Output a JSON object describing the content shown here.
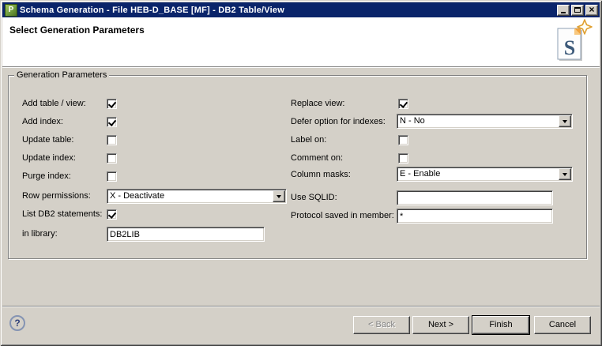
{
  "window": {
    "title": "Schema Generation - File HEB-D_BASE [MF] - DB2 Table/View",
    "app_icon_letter": "P",
    "close_glyph": "×"
  },
  "header": {
    "title": "Select Generation Parameters",
    "icon_letter": "S"
  },
  "group": {
    "title": "Generation Parameters"
  },
  "form": {
    "left": {
      "add_table_view": {
        "label": "Add table / view:",
        "checked": true
      },
      "add_index": {
        "label": "Add index:",
        "checked": true
      },
      "update_table": {
        "label": "Update table:",
        "checked": false
      },
      "update_index": {
        "label": "Update index:",
        "checked": false
      },
      "purge_index": {
        "label": "Purge index:",
        "checked": false
      },
      "row_permissions": {
        "label": "Row permissions:",
        "value": "X - Deactivate"
      },
      "list_db2_statements": {
        "label": "List DB2 statements:",
        "checked": true
      },
      "in_library": {
        "label": "in library:",
        "value": "DB2LIB"
      }
    },
    "right": {
      "replace_view": {
        "label": "Replace view:",
        "checked": true
      },
      "defer_option": {
        "label": "Defer option for indexes:",
        "value": "N - No"
      },
      "label_on": {
        "label": "Label on:",
        "checked": false
      },
      "comment_on": {
        "label": "Comment on:",
        "checked": false
      },
      "column_masks": {
        "label": "Column masks:",
        "value": "E - Enable"
      },
      "use_sqlid": {
        "label": "Use SQLID:",
        "value": ""
      },
      "protocol_member": {
        "label": "Protocol saved in member:",
        "value": "*"
      }
    }
  },
  "footer": {
    "help_glyph": "?",
    "buttons": {
      "back": {
        "label": "< Back",
        "disabled": true
      },
      "next": {
        "label": "Next >"
      },
      "finish": {
        "label": "Finish",
        "default": true
      },
      "cancel": {
        "label": "Cancel"
      }
    }
  },
  "colors": {
    "titlebar": "#0a246a",
    "dialog_face": "#d4d0c8",
    "header_bg": "#ffffff",
    "app_icon_green": "#6f9c3e",
    "star_gold": "#e0a030",
    "s_letter_blue": "#3d5a7a"
  }
}
